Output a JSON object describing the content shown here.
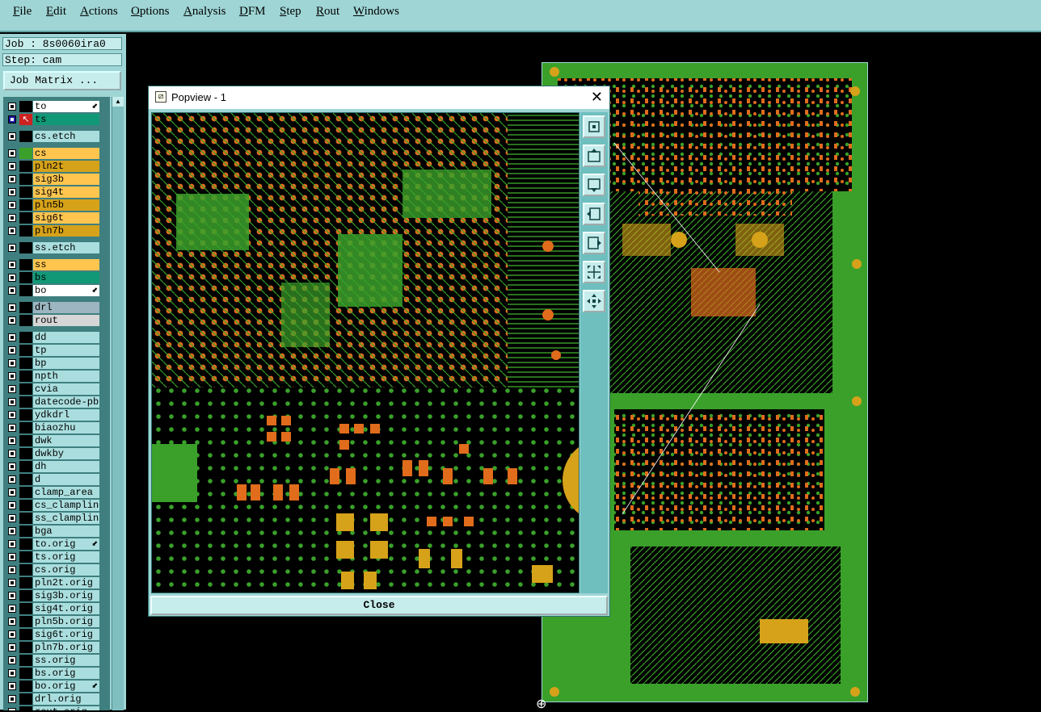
{
  "menu": [
    "File",
    "Edit",
    "Actions",
    "Options",
    "Analysis",
    "DFM",
    "Step",
    "Rout",
    "Windows"
  ],
  "job": {
    "job_label": "Job : 8s0060ira0",
    "step_label": "Step: cam",
    "matrix_button": "Job Matrix ..."
  },
  "layers": [
    {
      "name": "to",
      "color": "#ffffff",
      "sw": "#000000",
      "lock": true
    },
    {
      "name": "ts",
      "color": "#119977",
      "sw": "#cc2222",
      "active": true
    },
    {
      "name": "cs.etch",
      "color": "#aadede",
      "sw": "#000000",
      "gap": true
    },
    {
      "name": "cs",
      "color": "#ffc54f",
      "sw": "#3aa02a",
      "gap": true
    },
    {
      "name": "pln2t",
      "color": "#d6a21a",
      "sw": "#000000"
    },
    {
      "name": "sig3b",
      "color": "#ffc54f",
      "sw": "#000000"
    },
    {
      "name": "sig4t",
      "color": "#ffc54f",
      "sw": "#000000"
    },
    {
      "name": "pln5b",
      "color": "#d6a21a",
      "sw": "#000000"
    },
    {
      "name": "sig6t",
      "color": "#ffc54f",
      "sw": "#000000"
    },
    {
      "name": "pln7b",
      "color": "#d6a21a",
      "sw": "#000000"
    },
    {
      "name": "ss.etch",
      "color": "#aadede",
      "sw": "#000000",
      "gap": true
    },
    {
      "name": "ss",
      "color": "#ffc54f",
      "sw": "#000000",
      "gap": true
    },
    {
      "name": "bs",
      "color": "#119977",
      "sw": "#000000"
    },
    {
      "name": "bo",
      "color": "#ffffff",
      "sw": "#000000",
      "lock": true
    },
    {
      "name": "drl",
      "color": "#9cb5c0",
      "sw": "#000000",
      "gap": true
    },
    {
      "name": "rout",
      "color": "#d6d6d6",
      "sw": "#000000"
    },
    {
      "name": "dd",
      "color": "#aadede",
      "sw": "#000000",
      "gap": true
    },
    {
      "name": "tp",
      "color": "#aadede",
      "sw": "#000000"
    },
    {
      "name": "bp",
      "color": "#aadede",
      "sw": "#000000"
    },
    {
      "name": "npth",
      "color": "#aadede",
      "sw": "#000000"
    },
    {
      "name": "cvia",
      "color": "#aadede",
      "sw": "#000000"
    },
    {
      "name": "datecode-pbe",
      "color": "#aadede",
      "sw": "#000000"
    },
    {
      "name": "ydkdrl",
      "color": "#aadede",
      "sw": "#000000"
    },
    {
      "name": "biaozhu",
      "color": "#aadede",
      "sw": "#000000"
    },
    {
      "name": "dwk",
      "color": "#aadede",
      "sw": "#000000"
    },
    {
      "name": "dwkby",
      "color": "#aadede",
      "sw": "#000000"
    },
    {
      "name": "dh",
      "color": "#aadede",
      "sw": "#000000"
    },
    {
      "name": "d",
      "color": "#aadede",
      "sw": "#000000"
    },
    {
      "name": "clamp_area",
      "color": "#aadede",
      "sw": "#000000"
    },
    {
      "name": "cs_clamplines",
      "color": "#aadede",
      "sw": "#000000"
    },
    {
      "name": "ss_clamplines",
      "color": "#aadede",
      "sw": "#000000"
    },
    {
      "name": "bga",
      "color": "#aadede",
      "sw": "#000000"
    },
    {
      "name": "to.orig",
      "color": "#aadede",
      "sw": "#000000",
      "lock": true
    },
    {
      "name": "ts.orig",
      "color": "#aadede",
      "sw": "#000000"
    },
    {
      "name": "cs.orig",
      "color": "#aadede",
      "sw": "#000000"
    },
    {
      "name": "pln2t.orig",
      "color": "#aadede",
      "sw": "#000000"
    },
    {
      "name": "sig3b.orig",
      "color": "#aadede",
      "sw": "#000000"
    },
    {
      "name": "sig4t.orig",
      "color": "#aadede",
      "sw": "#000000"
    },
    {
      "name": "pln5b.orig",
      "color": "#aadede",
      "sw": "#000000"
    },
    {
      "name": "sig6t.orig",
      "color": "#aadede",
      "sw": "#000000"
    },
    {
      "name": "pln7b.orig",
      "color": "#aadede",
      "sw": "#000000"
    },
    {
      "name": "ss.orig",
      "color": "#aadede",
      "sw": "#000000"
    },
    {
      "name": "bs.orig",
      "color": "#aadede",
      "sw": "#000000"
    },
    {
      "name": "bo.orig",
      "color": "#aadede",
      "sw": "#000000",
      "lock": true
    },
    {
      "name": "drl.orig",
      "color": "#aadede",
      "sw": "#000000"
    },
    {
      "name": "rout.orig",
      "color": "#aadede",
      "sw": "#000000"
    }
  ],
  "popup": {
    "title": "Popview - 1",
    "close_label": "Close",
    "tools": [
      "zoom-window-icon",
      "pan-up-icon",
      "pan-down-icon",
      "pan-left-icon",
      "pan-right-icon",
      "zoom-fit-icon",
      "zoom-reset-icon"
    ]
  },
  "colors": {
    "copper": "#3aa02a",
    "pad": "#e06c1c",
    "gold": "#d6a21a",
    "panel": "#9fd5d5"
  }
}
